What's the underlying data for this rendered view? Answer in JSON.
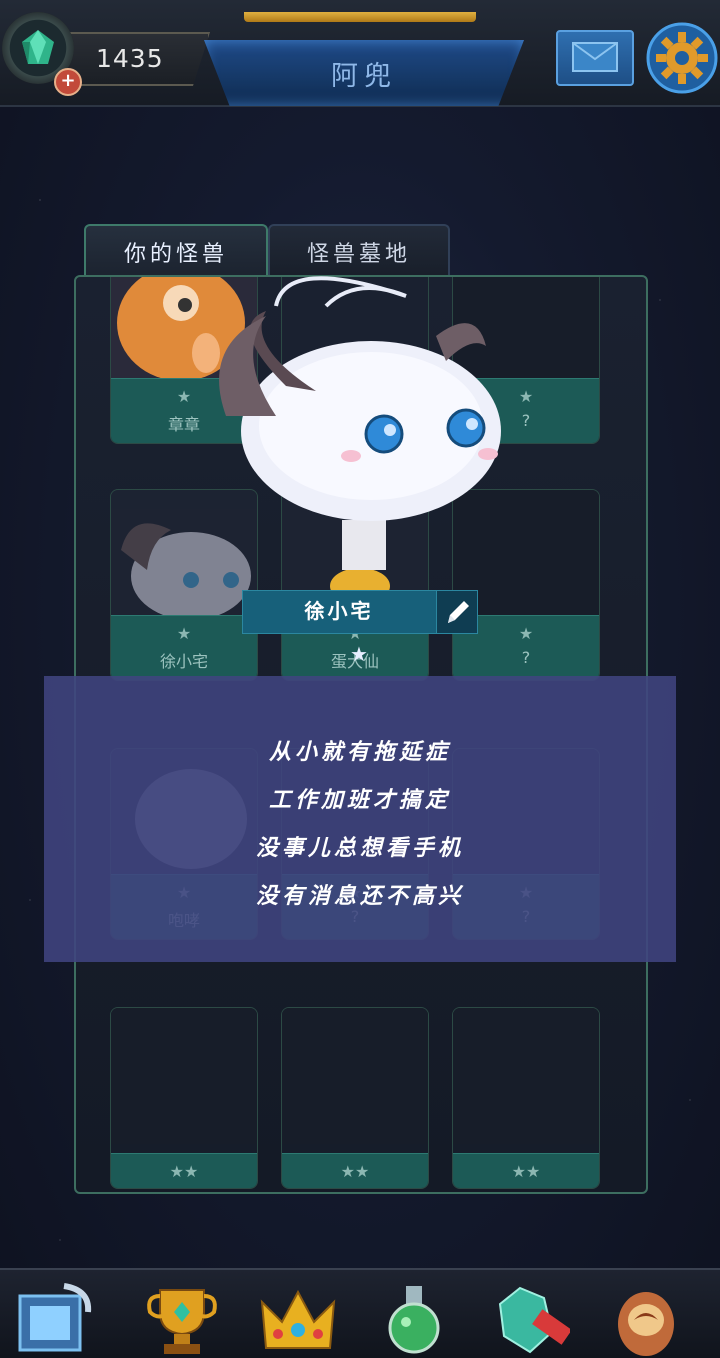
{
  "header": {
    "currency_value": "1435",
    "add_label": "+",
    "title": "阿兜"
  },
  "tabs": [
    {
      "label": "你的怪兽",
      "active": true
    },
    {
      "label": "怪兽墓地",
      "active": false
    }
  ],
  "cards": [
    {
      "name": "章章",
      "stars": "★",
      "portrait": "orange-octopus"
    },
    {
      "name": "",
      "stars": "★",
      "portrait": "hidden"
    },
    {
      "name": "?",
      "stars": "★",
      "portrait": "silhouette"
    },
    {
      "name": "徐小宅",
      "stars": "★",
      "portrait": "white-poro"
    },
    {
      "name": "蛋大仙",
      "stars": "★",
      "portrait": "yellow-creature"
    },
    {
      "name": "?",
      "stars": "★",
      "portrait": "silhouette"
    },
    {
      "name": "咆哮",
      "stars": "★",
      "portrait": "white-beast"
    },
    {
      "name": "?",
      "stars": "★",
      "portrait": "silhouette"
    },
    {
      "name": "?",
      "stars": "★",
      "portrait": "silhouette"
    },
    {
      "name": "",
      "stars": "★★",
      "portrait": "silhouette"
    },
    {
      "name": "",
      "stars": "★★",
      "portrait": "silhouette"
    },
    {
      "name": "",
      "stars": "★★",
      "portrait": "silhouette"
    }
  ],
  "selected": {
    "name": "徐小宅",
    "stars": "★",
    "description": [
      "从小就有拖延症",
      "工作加班才搞定",
      "没事儿总想看手机",
      "没有消息还不高兴"
    ]
  },
  "nav": [
    "monster-collection-icon",
    "trophy-icon",
    "crown-icon",
    "potion-icon",
    "crystal-sale-icon",
    "egg-icon"
  ],
  "colors": {
    "accent": "#3d6e60",
    "card_footer": "#1c5a56",
    "overlay": "#404480",
    "name_plate": "#17607a"
  }
}
